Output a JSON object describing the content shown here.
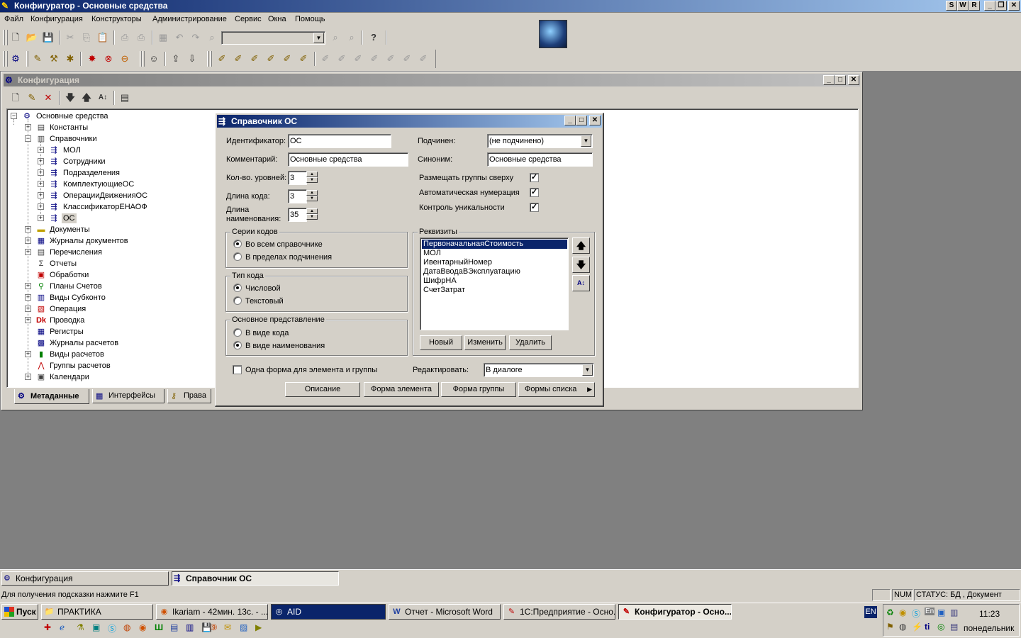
{
  "app": {
    "title": "Конфигуратор - Основные средства",
    "right_buttons": [
      "S",
      "W",
      "R"
    ]
  },
  "menu": [
    "Файл",
    "Конфигурация",
    "Конструкторы",
    "Администрирование",
    "Сервис",
    "Окна",
    "Помощь"
  ],
  "config_window": {
    "title": "Конфигурация",
    "tabs": [
      "Метаданные",
      "Интерфейсы",
      "Права"
    ],
    "tree": [
      {
        "label": "Основные средства",
        "level": 0,
        "icon": "config-root-icon"
      },
      {
        "label": "Константы",
        "level": 1,
        "icon": "constants-icon"
      },
      {
        "label": "Справочники",
        "level": 1,
        "icon": "catalogs-icon"
      },
      {
        "label": "МОЛ",
        "level": 2,
        "icon": "catalog-item-icon"
      },
      {
        "label": "Сотрудники",
        "level": 2,
        "icon": "catalog-item-icon"
      },
      {
        "label": "Подразделения",
        "level": 2,
        "icon": "catalog-item-icon"
      },
      {
        "label": "КомплектующиеОС",
        "level": 2,
        "icon": "catalog-item-icon"
      },
      {
        "label": "ОперацииДвиженияОС",
        "level": 2,
        "icon": "catalog-item-icon"
      },
      {
        "label": "КлассификаторЕНАОФ",
        "level": 2,
        "icon": "catalog-item-icon"
      },
      {
        "label": "ОС",
        "level": 2,
        "icon": "catalog-item-icon"
      },
      {
        "label": "Документы",
        "level": 1,
        "icon": "documents-icon"
      },
      {
        "label": "Журналы документов",
        "level": 1,
        "icon": "journals-icon"
      },
      {
        "label": "Перечисления",
        "level": 1,
        "icon": "enums-icon"
      },
      {
        "label": "Отчеты",
        "level": 1,
        "icon": "reports-icon"
      },
      {
        "label": "Обработки",
        "level": 1,
        "icon": "processing-icon"
      },
      {
        "label": "Планы Счетов",
        "level": 1,
        "icon": "chart-of-accounts-icon"
      },
      {
        "label": "Виды Субконто",
        "level": 1,
        "icon": "subconto-icon"
      },
      {
        "label": "Операция",
        "level": 1,
        "icon": "operation-icon"
      },
      {
        "label": "Проводка",
        "level": 1,
        "icon": "posting-icon"
      },
      {
        "label": "Регистры",
        "level": 1,
        "icon": "registers-icon"
      },
      {
        "label": "Журналы расчетов",
        "level": 1,
        "icon": "calc-journals-icon"
      },
      {
        "label": "Виды расчетов",
        "level": 1,
        "icon": "calc-kinds-icon"
      },
      {
        "label": "Группы расчетов",
        "level": 1,
        "icon": "calc-groups-icon"
      },
      {
        "label": "Календари",
        "level": 1,
        "icon": "calendars-icon"
      }
    ]
  },
  "dialog": {
    "title": "Справочник ОС",
    "identifier_label": "Идентификатор:",
    "identifier_value": "ОС",
    "comment_label": "Комментарий:",
    "comment_value": "Основные средства",
    "subordinate_label": "Подчинен:",
    "subordinate_value": "(не подчинено)",
    "synonym_label": "Синоним:",
    "synonym_value": "Основные средства",
    "levels_label": "Кол-во. уровней:",
    "levels_value": "3",
    "code_length_label": "Длина кода:",
    "code_length_value": "3",
    "name_length_label_1": "Длина",
    "name_length_label_2": "наименования:",
    "name_length_value": "35",
    "check_groups_top": "Размещать группы сверху",
    "check_auto_number": "Автоматическая нумерация",
    "check_unique": "Контроль уникальности",
    "code_series": {
      "title": "Серии кодов",
      "option_1": "Во всем справочнике",
      "option_2": "В пределах подчинения",
      "selected": 1
    },
    "code_type": {
      "title": "Тип кода",
      "option_1": "Числовой",
      "option_2": "Текстовый",
      "selected": 1
    },
    "main_view": {
      "title": "Основное представление",
      "option_1": "В виде кода",
      "option_2": "В виде наименования",
      "selected": 2
    },
    "requisites": {
      "title": "Реквизиты",
      "items": [
        "ПервоначальнаяСтоимость",
        "МОЛ",
        "ИвентарныйНомер",
        "ДатаВводаВЭксплуатацию",
        "ШифрНА",
        "СчетЗатрат"
      ],
      "selected_index": 0,
      "new_button": "Новый",
      "edit_button": "Изменить",
      "delete_button": "Удалить"
    },
    "one_form_label": "Одна форма для элемента и группы",
    "edit_label": "Редактировать:",
    "edit_value": "В диалоге",
    "btn_description": "Описание",
    "btn_element_form": "Форма элемента",
    "btn_group_form": "Форма группы",
    "btn_list_forms": "Формы списка"
  },
  "mdi_tabs": [
    "Конфигурация",
    "Справочник ОС"
  ],
  "statusbar": {
    "hint": "Для получения подсказки нажмите F1",
    "num": "NUM",
    "status": "СТАТУС: БД , Документ"
  },
  "taskbar": {
    "start": "Пуск",
    "tasks": [
      "ПРАКТИКА",
      "Ikariam - 42мин. 13с. - ...",
      "AID",
      "Отчет - Microsoft Word",
      "1С:Предприятие - Осно...",
      "Конфигуратор - Осно..."
    ],
    "lang": "EN",
    "time": "11:23",
    "day": "понедельник"
  },
  "colors": {
    "face": "#d4d0c8",
    "title_active": "#0a246a",
    "selection": "#0a246a",
    "desktop": "#808080"
  }
}
